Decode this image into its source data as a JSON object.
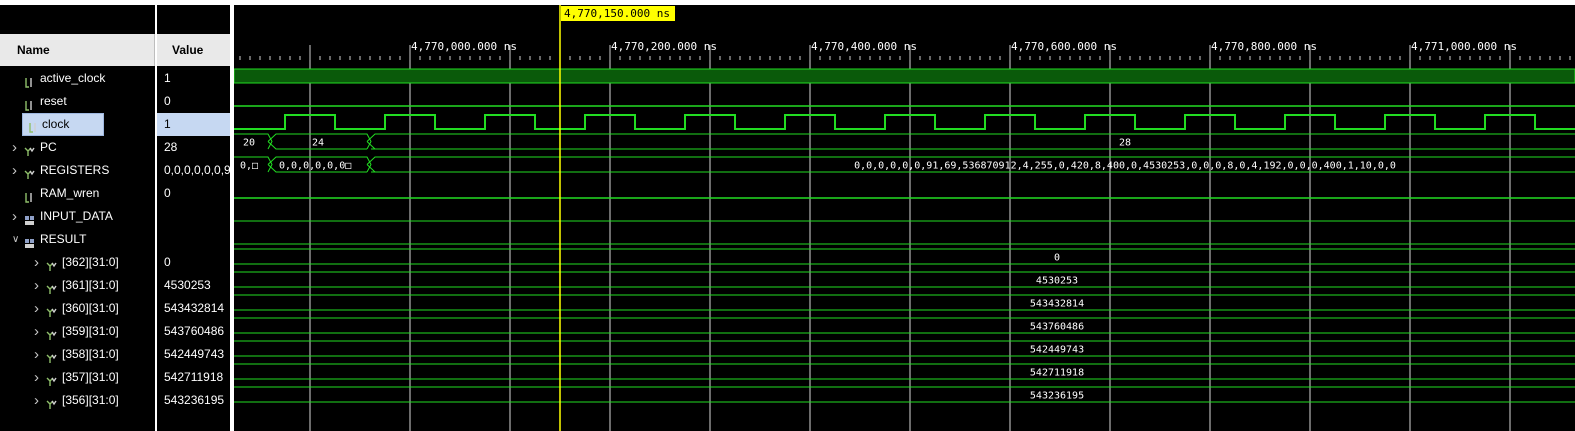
{
  "columns": {
    "name": "Name",
    "value": "Value"
  },
  "cursor_time": "4,770,150.000 ns",
  "time_labels": [
    "4,770,000.000 ns",
    "4,770,200.000 ns",
    "4,770,400.000 ns",
    "4,770,600.000 ns",
    "4,770,800.000 ns",
    "4,771,000.000 ns"
  ],
  "signals": [
    {
      "name": "active_clock",
      "value": "1",
      "icon": "bit-signal-icon",
      "expand": false,
      "indent": 0
    },
    {
      "name": "reset",
      "value": "0",
      "icon": "bit-signal-icon",
      "expand": false,
      "indent": 0
    },
    {
      "name": "clock",
      "value": "1",
      "icon": "bit-signal-icon",
      "expand": false,
      "indent": 0,
      "selected": true
    },
    {
      "name": "PC",
      "value": "28",
      "icon": "bus-signal-icon",
      "expand": "collapsed",
      "indent": 0
    },
    {
      "name": "REGISTERS",
      "value": "0,0,0,0,0,0,9",
      "icon": "bus-signal-icon",
      "expand": "collapsed",
      "indent": 0
    },
    {
      "name": "RAM_wren",
      "value": "0",
      "icon": "bit-signal-icon",
      "expand": false,
      "indent": 0
    },
    {
      "name": "INPUT_DATA",
      "value": "",
      "icon": "array-signal-icon",
      "expand": "collapsed",
      "indent": 0
    },
    {
      "name": "RESULT",
      "value": "",
      "icon": "array-signal-icon",
      "expand": "expanded",
      "indent": 0
    },
    {
      "name": "[362][31:0]",
      "value": "0",
      "icon": "bus-signal-icon",
      "expand": "collapsed",
      "indent": 1
    },
    {
      "name": "[361][31:0]",
      "value": "4530253",
      "icon": "bus-signal-icon",
      "expand": "collapsed",
      "indent": 1
    },
    {
      "name": "[360][31:0]",
      "value": "543432814",
      "icon": "bus-signal-icon",
      "expand": "collapsed",
      "indent": 1
    },
    {
      "name": "[359][31:0]",
      "value": "543760486",
      "icon": "bus-signal-icon",
      "expand": "collapsed",
      "indent": 1
    },
    {
      "name": "[358][31:0]",
      "value": "542449743",
      "icon": "bus-signal-icon",
      "expand": "collapsed",
      "indent": 1
    },
    {
      "name": "[357][31:0]",
      "value": "542711918",
      "icon": "bus-signal-icon",
      "expand": "collapsed",
      "indent": 1
    },
    {
      "name": "[356][31:0]",
      "value": "543236195",
      "icon": "bus-signal-icon",
      "expand": "collapsed",
      "indent": 1
    }
  ],
  "bus_labels": {
    "pc": [
      "20",
      "24",
      "28"
    ],
    "registers": [
      "0,□",
      "0,0,0,0,0,0□",
      "0,0,0,0,0,0,91,69,536870912,4,255,0,420,8,400,0,4530253,0,0,0,8,0,4,192,0,0,0,400,1,10,0,0"
    ],
    "result": [
      "0",
      "4530253",
      "543432814",
      "543760486",
      "542449743",
      "542711918",
      "543236195"
    ]
  },
  "colors": {
    "wave": "#22dd22",
    "fill": "#0a5a0a",
    "cursor": "#ffff00",
    "selection": "#c6d8f2"
  }
}
